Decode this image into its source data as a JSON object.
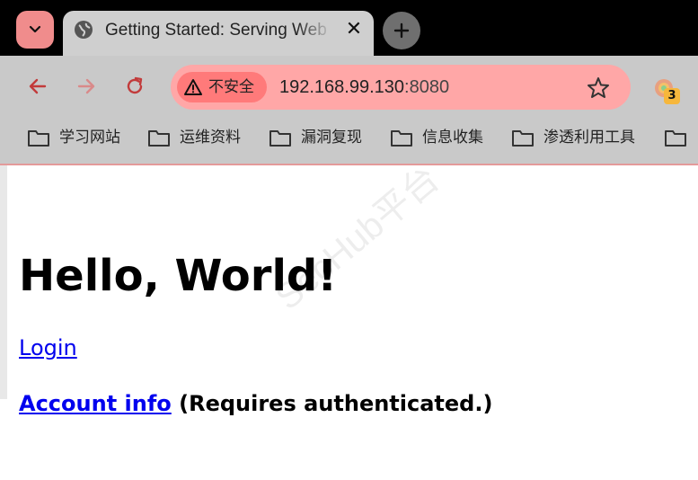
{
  "browser": {
    "tab": {
      "title": "Getting Started: Serving Web Content",
      "close_glyph": "✕"
    },
    "address_bar": {
      "security_label": "不安全",
      "url_host": "192.168.99.130",
      "url_port": ":8080"
    },
    "extension_badge": "3",
    "bookmarks": [
      {
        "label": "学习网站"
      },
      {
        "label": "运维资料"
      },
      {
        "label": "漏洞复现"
      },
      {
        "label": "信息收集"
      },
      {
        "label": "渗透利用工具"
      }
    ],
    "colors": {
      "omnibox_bg": "#ffa7a7",
      "security_chip_bg": "#ff7a7a",
      "accent_red": "#c23b3b"
    }
  },
  "page": {
    "heading": "Hello, World!",
    "login_link": "Login",
    "account_link": "Account info",
    "account_note": "(Requires authenticated.)",
    "watermark": "SecHub平台"
  }
}
